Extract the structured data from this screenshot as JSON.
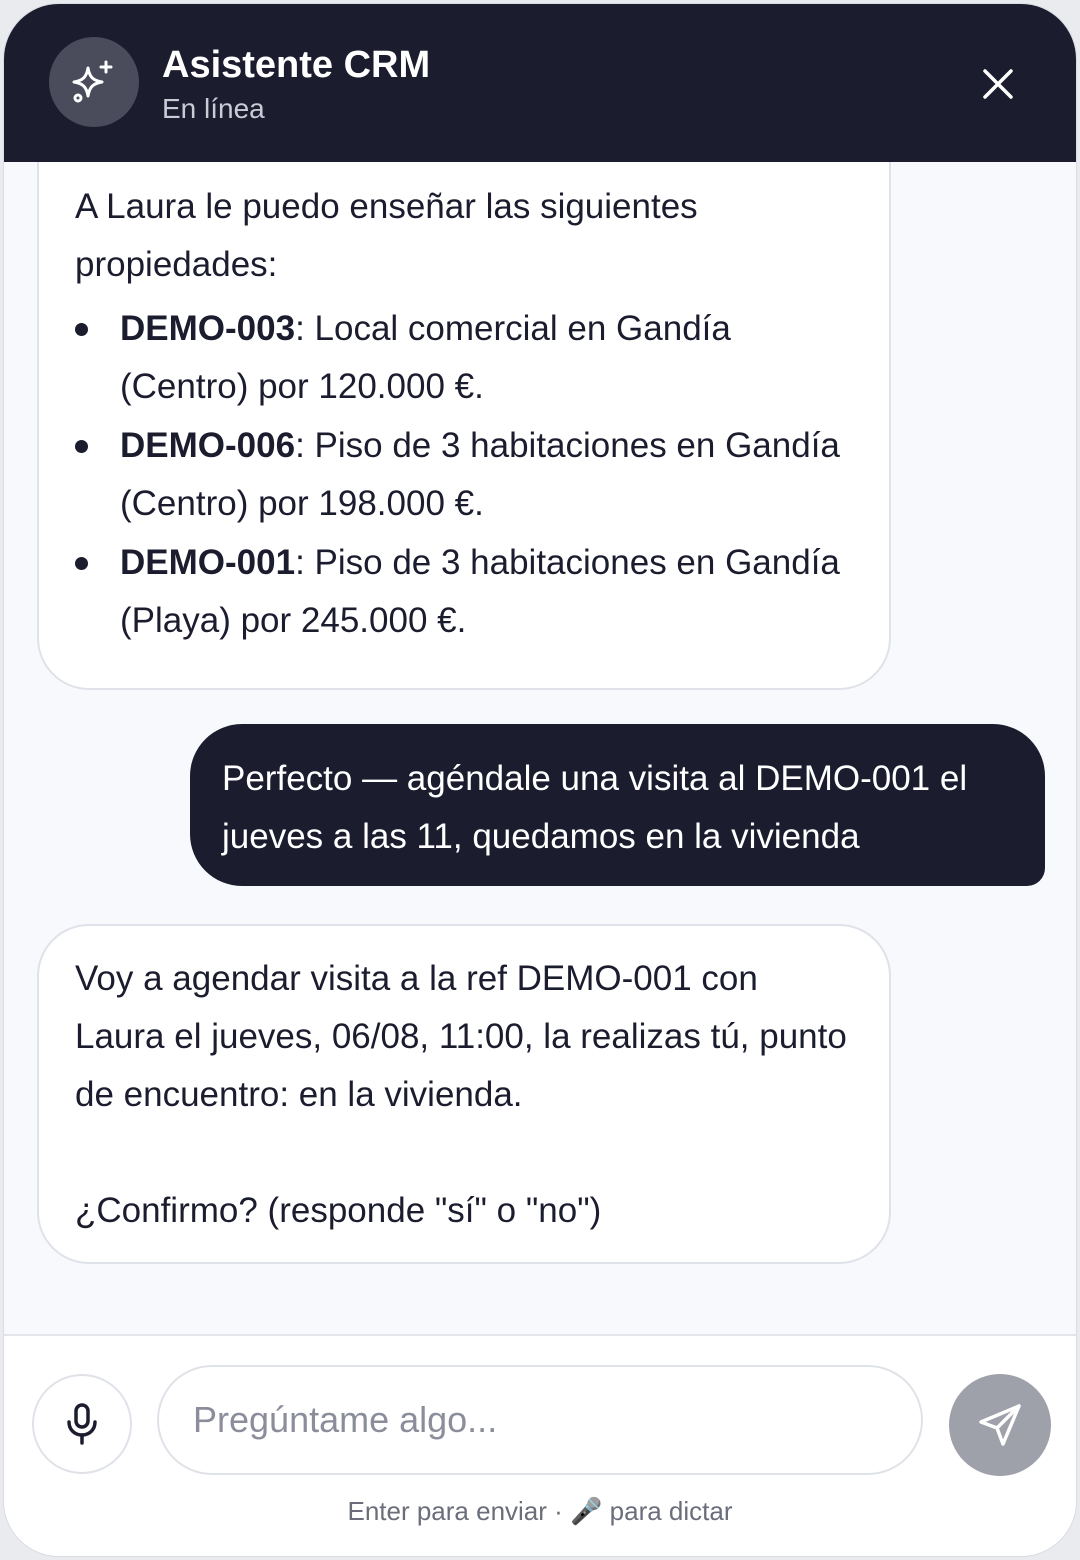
{
  "header": {
    "title": "Asistente CRM",
    "status": "En línea",
    "avatar_icon": "sparkles-icon",
    "close_icon": "close-icon"
  },
  "messages": [
    {
      "role": "assistant",
      "intro": "A Laura le puedo enseñar las siguientes propiedades:",
      "items": [
        {
          "ref": "DEMO-003",
          "text": ": Local comercial en Gandía (Centro) por 120.000 €."
        },
        {
          "ref": "DEMO-006",
          "text": ": Piso de 3 habitaciones en Gandía (Centro) por 198.000 €."
        },
        {
          "ref": "DEMO-001",
          "text": ": Piso de 3 habitaciones en Gandía (Playa) por 245.000 €."
        }
      ]
    },
    {
      "role": "user",
      "text": "Perfecto — agéndale una visita al DEMO-001 el jueves a las 11, quedamos en la vivienda"
    },
    {
      "role": "assistant",
      "text": "Voy a agendar visita a la ref DEMO-001 con Laura el jueves, 06/08, 11:00, la realizas tú, punto de encuentro: en la vivienda.",
      "question": "¿Confirmo? (responde \"sí\" o \"no\")"
    }
  ],
  "composer": {
    "placeholder": "Pregúntame algo...",
    "value": "",
    "hint_prefix": "Enter para enviar ·",
    "hint_mic_glyph": "🎤",
    "hint_suffix": "para dictar",
    "mic_icon": "microphone-icon",
    "send_icon": "send-icon"
  },
  "colors": {
    "header_bg": "#1b1d2f",
    "user_bubble": "#1b1d2f",
    "send_button": "#9fa1aa",
    "background": "#f8f9fc"
  }
}
